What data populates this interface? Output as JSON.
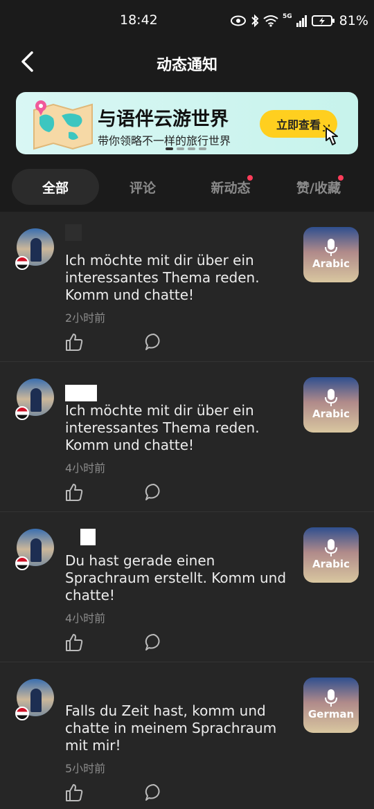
{
  "status_bar": {
    "time": "18:42",
    "network": "5G",
    "battery": "81%"
  },
  "header": {
    "title": "动态通知"
  },
  "banner": {
    "title": "与语伴云游世界",
    "subtitle": "带你领略不一样的旅行世界",
    "cta": "立即查看",
    "dots": 4,
    "active_dot": 0
  },
  "tabs": [
    {
      "label": "全部",
      "active": true,
      "dot": false
    },
    {
      "label": "评论",
      "active": false,
      "dot": false
    },
    {
      "label": "新动态",
      "active": false,
      "dot": true
    },
    {
      "label": "赞/收藏",
      "active": false,
      "dot": true
    }
  ],
  "feed": [
    {
      "message": "Ich möchte mit dir über ein interessantes Thema reden. Komm und chatte!",
      "time": "2小时前",
      "thumb_label": "Arabic"
    },
    {
      "message": "Ich möchte mit dir über ein interessantes Thema reden. Komm und chatte!",
      "time": "4小时前",
      "thumb_label": "Arabic"
    },
    {
      "message": "Du hast gerade einen Sprachraum erstellt. Komm und chatte!",
      "time": "4小时前",
      "thumb_label": "Arabic"
    },
    {
      "message": "Falls du Zeit hast, komm und chatte in meinem Sprachraum mit mir!",
      "time": "5小时前",
      "thumb_label": "German"
    }
  ],
  "icons": {
    "back": "back-chevron-icon",
    "like": "thumbs-up-icon",
    "comment": "comment-bubble-icon",
    "mic": "microphone-icon"
  },
  "colors": {
    "background": "#262626",
    "header_bg": "#1b1b1b",
    "cta_yellow": "#ffcf1f",
    "notification_dot": "#ff3d5a"
  }
}
